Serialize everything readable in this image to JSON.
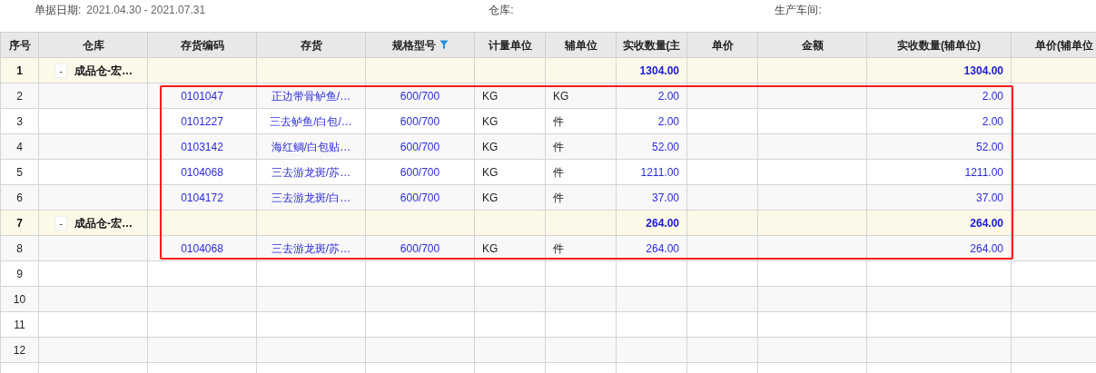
{
  "filters": [
    {
      "label": "单据日期:",
      "value": "2021.04.30 - 2021.07.31"
    },
    {
      "label": "仓库:"
    },
    {
      "label": "生产车间:"
    }
  ],
  "columns": [
    {
      "label": "序号",
      "filtered": false
    },
    {
      "label": "仓库",
      "filtered": false
    },
    {
      "label": "存货编码",
      "filtered": false
    },
    {
      "label": "存货",
      "filtered": false
    },
    {
      "label": "规格型号",
      "filtered": true
    },
    {
      "label": "计量单位",
      "filtered": false
    },
    {
      "label": "辅单位",
      "filtered": false
    },
    {
      "label": "实收数量(主",
      "filtered": false
    },
    {
      "label": "单价",
      "filtered": false
    },
    {
      "label": "金额",
      "filtered": false
    },
    {
      "label": "实收数量(辅单位)",
      "filtered": false
    },
    {
      "label": "单价(辅单位",
      "filtered": false
    }
  ],
  "rows": [
    {
      "kind": "group",
      "seq": "1",
      "toggle": "-",
      "warehouse": "成品仓-宏…",
      "qty_main": "1304.00",
      "qty_aux": "1304.00"
    },
    {
      "kind": "item",
      "seq": "2",
      "code": "0101047",
      "name": "正边带骨鲈鱼/…",
      "spec": "600/700",
      "unit": "KG",
      "aux_unit": "KG",
      "qty_main": "2.00",
      "qty_aux": "2.00"
    },
    {
      "kind": "item",
      "seq": "3",
      "code": "0101227",
      "name": "三去鲈鱼/白包/…",
      "spec": "600/700",
      "unit": "KG",
      "aux_unit": "件",
      "qty_main": "2.00",
      "qty_aux": "2.00"
    },
    {
      "kind": "item",
      "seq": "4",
      "code": "0103142",
      "name": "海红鲷/白包贴…",
      "spec": "600/700",
      "unit": "KG",
      "aux_unit": "件",
      "qty_main": "52.00",
      "qty_aux": "52.00"
    },
    {
      "kind": "item",
      "seq": "5",
      "code": "0104068",
      "name": "三去游龙斑/苏…",
      "spec": "600/700",
      "unit": "KG",
      "aux_unit": "件",
      "qty_main": "1211.00",
      "qty_aux": "1211.00"
    },
    {
      "kind": "item",
      "seq": "6",
      "code": "0104172",
      "name": "三去游龙斑/白…",
      "spec": "600/700",
      "unit": "KG",
      "aux_unit": "件",
      "qty_main": "37.00",
      "qty_aux": "37.00"
    },
    {
      "kind": "group",
      "seq": "7",
      "toggle": "-",
      "warehouse": "成品仓-宏…",
      "qty_main": "264.00",
      "qty_aux": "264.00"
    },
    {
      "kind": "item",
      "seq": "8",
      "code": "0104068",
      "name": "三去游龙斑/苏…",
      "spec": "600/700",
      "unit": "KG",
      "aux_unit": "件",
      "qty_main": "264.00",
      "qty_aux": "264.00"
    },
    {
      "kind": "empty",
      "seq": "9"
    },
    {
      "kind": "empty",
      "seq": "10"
    },
    {
      "kind": "empty",
      "seq": "11"
    },
    {
      "kind": "empty",
      "seq": "12"
    }
  ]
}
